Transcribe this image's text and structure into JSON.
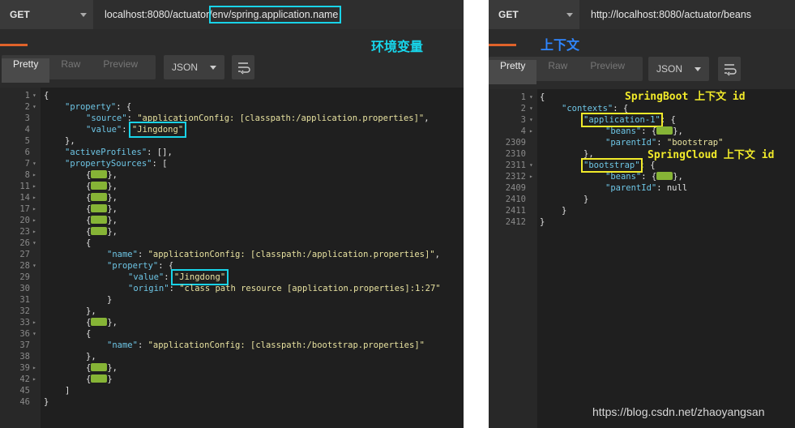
{
  "left": {
    "method": "GET",
    "url_prefix": "localhost:8080/actuator/",
    "url_highlight": "env/spring.application.name",
    "annotation": "环境变量",
    "tabs": [
      "Pretty",
      "Raw",
      "Preview"
    ],
    "format": "JSON",
    "lines": [
      {
        "n": "1",
        "f": "▾",
        "d": 0,
        "t": "{"
      },
      {
        "n": "2",
        "f": "▾",
        "d": 1,
        "k": "\"property\"",
        "t": ": {"
      },
      {
        "n": "3",
        "f": "",
        "d": 2,
        "k": "\"source\"",
        "t": ": ",
        "s": "\"applicationConfig: [classpath:/application.properties]\"",
        "tail": ","
      },
      {
        "n": "4",
        "f": "",
        "d": 2,
        "k": "\"value\"",
        "t": ": ",
        "s": "\"Jingdong\""
      },
      {
        "n": "5",
        "f": "",
        "d": 1,
        "t": "},"
      },
      {
        "n": "6",
        "f": "",
        "d": 1,
        "k": "\"activeProfiles\"",
        "t": ": [],"
      },
      {
        "n": "7",
        "f": "▾",
        "d": 1,
        "k": "\"propertySources\"",
        "t": ": ["
      },
      {
        "n": "8",
        "f": "▸",
        "d": 2,
        "t": "{",
        "pill": true,
        "tail": "},"
      },
      {
        "n": "11",
        "f": "▸",
        "d": 2,
        "t": "{",
        "pill": true,
        "tail": "},"
      },
      {
        "n": "14",
        "f": "▸",
        "d": 2,
        "t": "{",
        "pill": true,
        "tail": "},"
      },
      {
        "n": "17",
        "f": "▸",
        "d": 2,
        "t": "{",
        "pill": true,
        "tail": "},"
      },
      {
        "n": "20",
        "f": "▸",
        "d": 2,
        "t": "{",
        "pill": true,
        "tail": "},"
      },
      {
        "n": "23",
        "f": "▸",
        "d": 2,
        "t": "{",
        "pill": true,
        "tail": "},"
      },
      {
        "n": "26",
        "f": "▾",
        "d": 2,
        "t": "{"
      },
      {
        "n": "27",
        "f": "",
        "d": 3,
        "k": "\"name\"",
        "t": ": ",
        "s": "\"applicationConfig: [classpath:/application.properties]\"",
        "tail": ","
      },
      {
        "n": "28",
        "f": "▾",
        "d": 3,
        "k": "\"property\"",
        "t": ": {"
      },
      {
        "n": "29",
        "f": "",
        "d": 4,
        "k": "\"value\"",
        "t": ": ",
        "s": "\"Jingdong\"",
        "tail": ","
      },
      {
        "n": "30",
        "f": "",
        "d": 4,
        "k": "\"origin\"",
        "t": ": ",
        "s": "\"class path resource [application.properties]:1:27\""
      },
      {
        "n": "31",
        "f": "",
        "d": 3,
        "t": "}"
      },
      {
        "n": "32",
        "f": "",
        "d": 2,
        "t": "},"
      },
      {
        "n": "33",
        "f": "▸",
        "d": 2,
        "t": "{",
        "pill": true,
        "tail": "},"
      },
      {
        "n": "36",
        "f": "▾",
        "d": 2,
        "t": "{"
      },
      {
        "n": "37",
        "f": "",
        "d": 3,
        "k": "\"name\"",
        "t": ": ",
        "s": "\"applicationConfig: [classpath:/bootstrap.properties]\""
      },
      {
        "n": "38",
        "f": "",
        "d": 2,
        "t": "},"
      },
      {
        "n": "39",
        "f": "▸",
        "d": 2,
        "t": "{",
        "pill": true,
        "tail": "},"
      },
      {
        "n": "42",
        "f": "▸",
        "d": 2,
        "t": "{",
        "pill": true,
        "tail": "}"
      },
      {
        "n": "45",
        "f": "",
        "d": 1,
        "t": "]"
      },
      {
        "n": "46",
        "f": "",
        "d": 0,
        "t": "}"
      }
    ]
  },
  "right": {
    "method": "GET",
    "url": "http://localhost:8080/actuator/beans",
    "annotation_top": "上下文",
    "annotation_boot": "SpringBoot 上下文 id",
    "annotation_cloud": "SpringCloud 上下文 id",
    "tabs": [
      "Pretty",
      "Raw",
      "Preview"
    ],
    "format": "JSON",
    "lines": [
      {
        "n": "1",
        "f": "▾",
        "d": 0,
        "t": "{"
      },
      {
        "n": "2",
        "f": "▾",
        "d": 1,
        "k": "\"contexts\"",
        "t": ": {"
      },
      {
        "n": "3",
        "f": "▾",
        "d": 2,
        "k": "\"application-1\"",
        "t": ": {"
      },
      {
        "n": "4",
        "f": "▸",
        "d": 3,
        "k": "\"beans\"",
        "t": ": {",
        "pill": true,
        "tail": "},"
      },
      {
        "n": "2309",
        "f": "",
        "d": 3,
        "k": "\"parentId\"",
        "t": ": ",
        "s": "\"bootstrap\""
      },
      {
        "n": "2310",
        "f": "",
        "d": 2,
        "t": "},"
      },
      {
        "n": "2311",
        "f": "▾",
        "d": 2,
        "k": "\"bootstrap\"",
        "t": ": {"
      },
      {
        "n": "2312",
        "f": "▸",
        "d": 3,
        "k": "\"beans\"",
        "t": ": {",
        "pill": true,
        "tail": "},"
      },
      {
        "n": "2409",
        "f": "",
        "d": 3,
        "k": "\"parentId\"",
        "t": ": null"
      },
      {
        "n": "2410",
        "f": "",
        "d": 2,
        "t": "}"
      },
      {
        "n": "2411",
        "f": "",
        "d": 1,
        "t": "}"
      },
      {
        "n": "2412",
        "f": "",
        "d": 0,
        "t": "}"
      }
    ]
  },
  "watermark": "https://blog.csdn.net/zhaoyangsan",
  "colors": {
    "highlight_cyan": "#19d3e8",
    "highlight_yellow": "#f1ea2a",
    "accent_orange": "#e0632a",
    "pill_green": "#86b436"
  }
}
